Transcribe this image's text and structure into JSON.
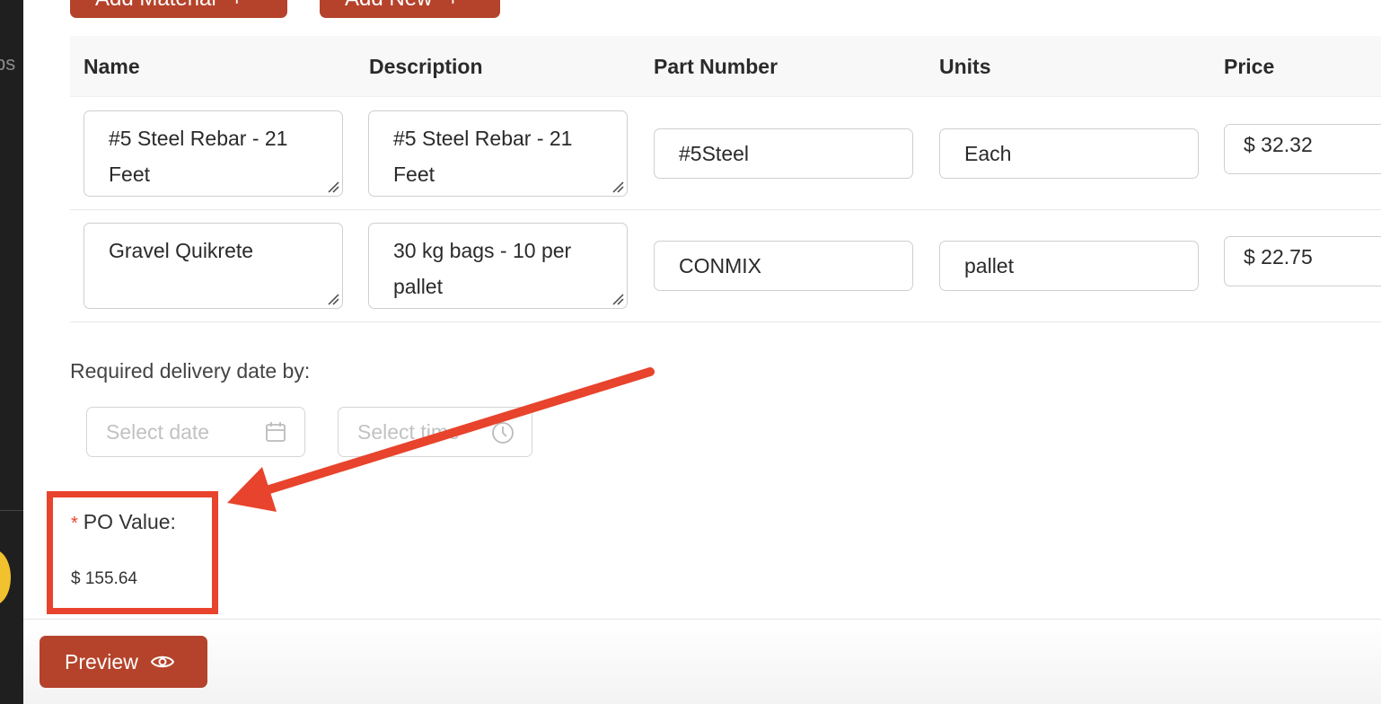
{
  "sidebar": {
    "partial_text": "ps"
  },
  "toolbar": {
    "add_material_label": "Add Material",
    "add_new_label": "Add New",
    "plus_icon": "plus-icon"
  },
  "table": {
    "headers": [
      "Name",
      "Description",
      "Part Number",
      "Units",
      "Price"
    ],
    "rows": [
      {
        "name": "#5 Steel Rebar - 21 Feet",
        "description": "#5 Steel Rebar - 21 Feet",
        "part_number": "#5Steel",
        "units": "Each",
        "price": "$ 32.32"
      },
      {
        "name": "Gravel Quikrete",
        "description": "30 kg bags - 10 per pallet",
        "part_number": "CONMIX",
        "units": "pallet",
        "price": "$ 22.75"
      }
    ]
  },
  "delivery": {
    "label": "Required delivery date by:",
    "date_placeholder": "Select date",
    "time_placeholder": "Select time",
    "date_icon": "calendar-icon",
    "time_icon": "clock-icon"
  },
  "po": {
    "required_marker": "*",
    "label": "PO Value:",
    "value": "$ 155.64"
  },
  "footer": {
    "preview_label": "Preview",
    "preview_icon": "eye-icon"
  },
  "colors": {
    "accent": "#b5432b",
    "annotation": "#e8432c",
    "sidebar": "#1f1f1f"
  }
}
